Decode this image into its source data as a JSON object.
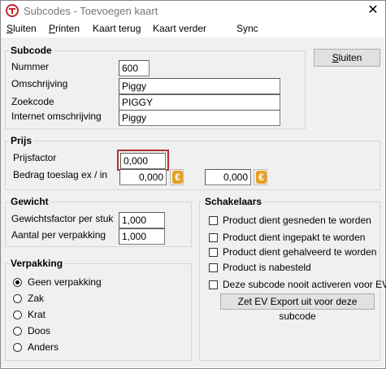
{
  "window": {
    "title": "Subcodes - Toevoegen kaart"
  },
  "menu": [
    {
      "label": "Sluiten",
      "mnemonic": "S",
      "rest": "luiten"
    },
    {
      "label": "Printen",
      "mnemonic": "P",
      "rest": "rinten"
    },
    {
      "label": "Kaart terug",
      "mnemonic": "",
      "rest": "Kaart terug"
    },
    {
      "label": "Kaart verder",
      "mnemonic": "",
      "rest": "Kaart verder"
    },
    {
      "label": "Sync",
      "mnemonic": "",
      "rest": "Sync"
    }
  ],
  "subcode": {
    "legend": "Subcode",
    "nummer_label": "Nummer",
    "nummer_value": "600",
    "omschrijving_label": "Omschrijving",
    "omschrijving_value": "Piggy",
    "zoekcode_label": "Zoekcode",
    "zoekcode_value": "PIGGY",
    "internet_label": "Internet omschrijving",
    "internet_value": "Piggy"
  },
  "sluiten_button": {
    "mnemonic": "S",
    "rest": "luiten"
  },
  "prijs": {
    "legend": "Prijs",
    "prijsfactor_label": "Prijsfactor",
    "prijsfactor_value": "0,000",
    "toeslag_label": "Bedrag toeslag ex / in",
    "toeslag_ex_value": "0,000",
    "toeslag_in_value": "0,000",
    "currency_symbol": "€"
  },
  "gewicht": {
    "legend": "Gewicht",
    "factor_label": "Gewichtsfactor per stuk",
    "factor_value": "1,000",
    "aantal_label": "Aantal per verpakking",
    "aantal_value": "1,000"
  },
  "verpakking": {
    "legend": "Verpakking",
    "options": [
      "Geen verpakking",
      "Zak",
      "Krat",
      "Doos",
      "Anders"
    ],
    "selected": "Geen verpakking"
  },
  "schakelaars": {
    "legend": "Schakelaars",
    "items": [
      "Product dient gesneden te worden",
      "Product dient ingepakt te worden",
      "Product dient gehalveerd te worden",
      "Product is nabesteld",
      "Deze subcode nooit activeren voor EV"
    ],
    "export_button": "Zet EV Export uit voor deze subcode"
  },
  "colors": {
    "accent": "#e8a020",
    "focus": "#b03030"
  }
}
